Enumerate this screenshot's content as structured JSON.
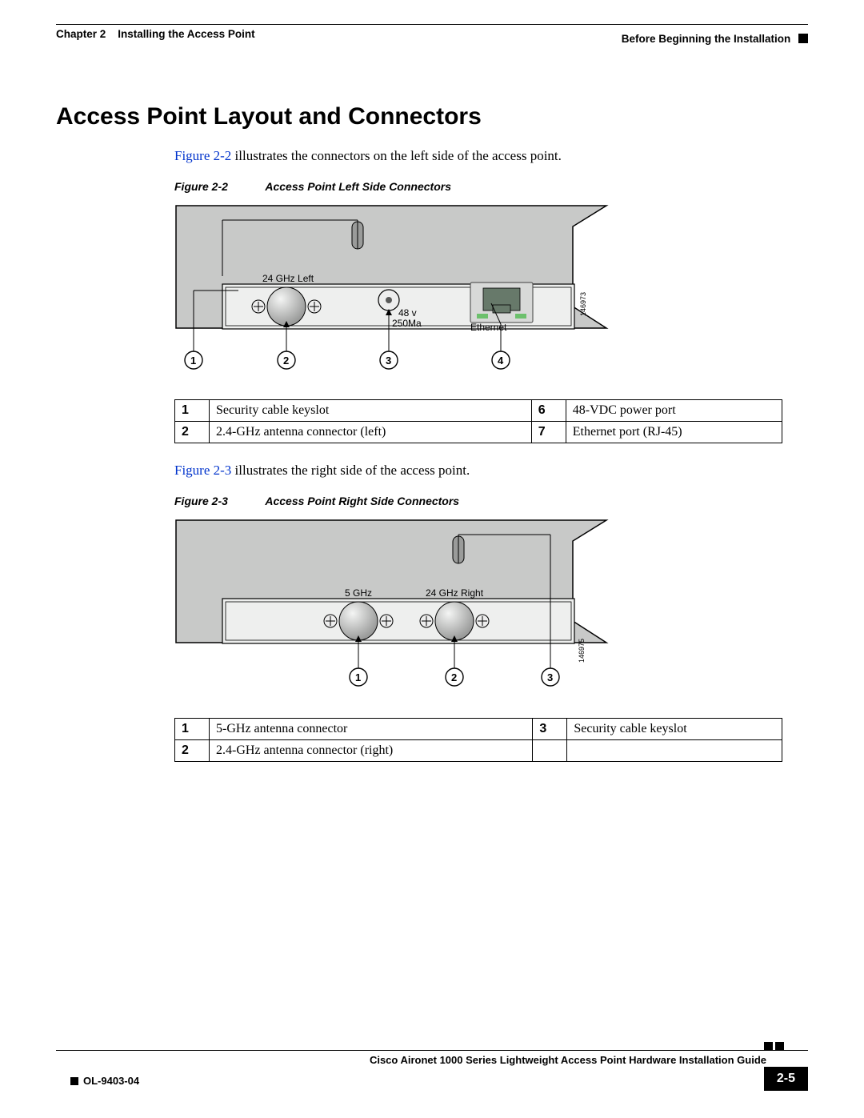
{
  "header": {
    "chapter": "Chapter 2",
    "chapter_title": "Installing the Access Point",
    "section": "Before Beginning the Installation"
  },
  "section_heading": "Access Point Layout and Connectors",
  "intro1_link": "Figure 2-2",
  "intro1_rest": " illustrates the connectors on the left side of the access point.",
  "figure1": {
    "num": "Figure 2-2",
    "title": "Access Point Left Side Connectors",
    "labels": {
      "antenna": "24 GHz Left",
      "power": "48 v\n250Ma",
      "ethernet": "Ethernet",
      "imageid": "146973"
    },
    "callouts": [
      "1",
      "2",
      "3",
      "4"
    ]
  },
  "table1": {
    "rows": [
      [
        "1",
        "Security cable keyslot",
        "6",
        "48-VDC power port"
      ],
      [
        "2",
        "2.4-GHz antenna connector (left)",
        "7",
        "Ethernet port (RJ-45)"
      ]
    ]
  },
  "intro2_link": "Figure 2-3",
  "intro2_rest": " illustrates the right side of the access point.",
  "figure2": {
    "num": "Figure 2-3",
    "title": "Access Point Right Side Connectors",
    "labels": {
      "ant5": "5 GHz",
      "ant24": "24 GHz Right",
      "imageid": "146975"
    },
    "callouts": [
      "1",
      "2",
      "3"
    ]
  },
  "table2": {
    "rows": [
      [
        "1",
        "5-GHz antenna connector",
        "3",
        "Security cable keyslot"
      ],
      [
        "2",
        "2.4-GHz antenna connector (right)",
        "",
        ""
      ]
    ]
  },
  "footer": {
    "doc_title": "Cisco Aironet 1000 Series Lightweight Access Point Hardware Installation Guide",
    "doc_num": "OL-9403-04",
    "page": "2-5"
  }
}
